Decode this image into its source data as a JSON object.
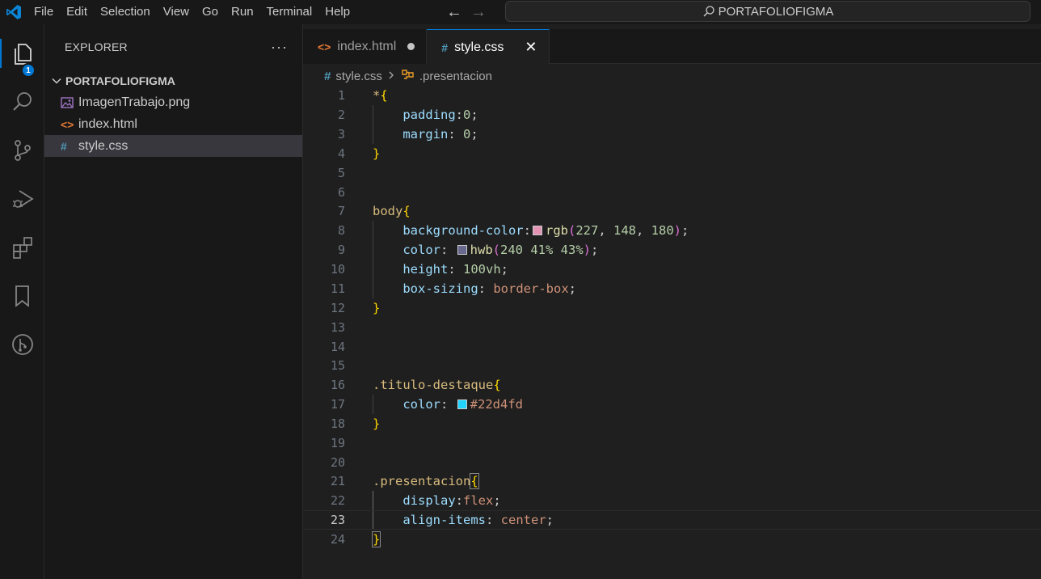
{
  "menu": [
    "File",
    "Edit",
    "Selection",
    "View",
    "Go",
    "Run",
    "Terminal",
    "Help"
  ],
  "command_center": "PORTAFOLIOFIGMA",
  "activity": {
    "explorer_badge": "1"
  },
  "sidebar": {
    "title": "EXPLORER",
    "more": "···",
    "folder": "PORTAFOLIOFIGMA",
    "files": [
      {
        "name": "ImagenTrabajo.png",
        "icon": "image-file-icon"
      },
      {
        "name": "index.html",
        "icon": "html-file-icon"
      },
      {
        "name": "style.css",
        "icon": "css-file-icon"
      }
    ]
  },
  "tabs": [
    {
      "label": "index.html",
      "icon_glyph": "<>",
      "modified": true
    },
    {
      "label": "style.css",
      "icon_glyph": "#",
      "active": true
    }
  ],
  "breadcrumb": {
    "file_glyph": "#",
    "file": "style.css",
    "symbol": ".presentacion"
  },
  "editor": {
    "current_line": 23,
    "line_numbers": [
      "1",
      "2",
      "3",
      "4",
      "5",
      "6",
      "7",
      "8",
      "9",
      "10",
      "11",
      "12",
      "13",
      "14",
      "15",
      "16",
      "17",
      "18",
      "19",
      "20",
      "21",
      "22",
      "23",
      "24"
    ],
    "code": {
      "l1_sel": "*",
      "l1_brace": "{",
      "l2_prop": "padding",
      "l2_colon": ":",
      "l2_val": "0",
      "l2_semi": ";",
      "l3_prop": "margin",
      "l3_colon": ": ",
      "l3_val": "0",
      "l3_semi": ";",
      "l4_brace": "}",
      "l7_sel": "body",
      "l7_brace": "{",
      "l8_prop": "background-color",
      "l8_colon": ":",
      "l8_fn": "rgb",
      "l8_open": "(",
      "l8_a": "227",
      "l8_c1": ", ",
      "l8_b": "148",
      "l8_c2": ", ",
      "l8_c": "180",
      "l8_close": ")",
      "l8_semi": ";",
      "l8_swatch": "#e394b4",
      "l9_prop": "color",
      "l9_colon": ": ",
      "l9_fn": "hwb",
      "l9_open": "(",
      "l9_args": "240 41% 43%",
      "l9_close": ")",
      "l9_semi": ";",
      "l9_swatch": "#69698f",
      "l10_prop": "height",
      "l10_colon": ": ",
      "l10_val": "100vh",
      "l10_semi": ";",
      "l11_prop": "box-sizing",
      "l11_colon": ": ",
      "l11_val": "border-box",
      "l11_semi": ";",
      "l12_brace": "}",
      "l16_sel": ".titulo-destaque",
      "l16_brace": "{",
      "l17_prop": "color",
      "l17_colon": ": ",
      "l17_val": "#22d4fd",
      "l17_swatch": "#22d4fd",
      "l18_brace": "}",
      "l21_sel": ".presentacion",
      "l21_brace": "{",
      "l22_prop": "display",
      "l22_colon": ":",
      "l22_val": "flex",
      "l22_semi": ";",
      "l23_prop": "align-items",
      "l23_colon": ": ",
      "l23_val": "center",
      "l23_semi": ";",
      "l24_brace": "}"
    }
  },
  "colors": {
    "accent": "#0078d4",
    "editor_bg": "#1f1f1f",
    "chrome_bg": "#181818"
  }
}
